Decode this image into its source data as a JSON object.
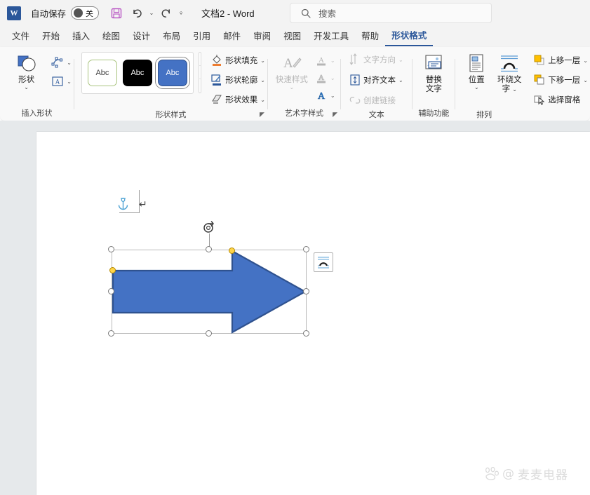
{
  "titlebar": {
    "app_icon": "word-logo-icon",
    "autosave_label": "自动保存",
    "autosave_state": "关",
    "save_icon": "save-icon",
    "undo_icon": "undo-icon",
    "redo_icon": "redo-icon",
    "qat_more_icon": "qat-customize-icon",
    "document_title": "文档2  -  Word"
  },
  "search": {
    "icon": "search-icon",
    "placeholder": "搜索"
  },
  "tabs": [
    {
      "label": "文件",
      "active": false
    },
    {
      "label": "开始",
      "active": false
    },
    {
      "label": "插入",
      "active": false
    },
    {
      "label": "绘图",
      "active": false
    },
    {
      "label": "设计",
      "active": false
    },
    {
      "label": "布局",
      "active": false
    },
    {
      "label": "引用",
      "active": false
    },
    {
      "label": "邮件",
      "active": false
    },
    {
      "label": "审阅",
      "active": false
    },
    {
      "label": "视图",
      "active": false
    },
    {
      "label": "开发工具",
      "active": false
    },
    {
      "label": "帮助",
      "active": false
    },
    {
      "label": "形状格式",
      "active": true
    }
  ],
  "ribbon": {
    "groups": [
      {
        "name": "insert-shapes",
        "label": "插入形状",
        "shapes_button": {
          "label": "形状",
          "icon": "shapes-icon",
          "chevron": "⌄"
        },
        "edit_shape_icon": "edit-shape-icon",
        "text_box_icon": "text-box-icon"
      },
      {
        "name": "shape-styles",
        "label": "形状样式",
        "gallery": [
          {
            "name": "style-subtle-line",
            "text": "Abc",
            "fill": "#ffffff",
            "border": "#a9c47f",
            "selected": false
          },
          {
            "name": "style-intense-fill-black",
            "text": "Abc",
            "fill": "#000000",
            "border": "#000000",
            "selected": false
          },
          {
            "name": "style-colored-fill-blue",
            "text": "Abc",
            "fill": "#4472c4",
            "border": "#2f528f",
            "selected": true
          }
        ],
        "gallery_nav": {
          "up": "⌃",
          "down": "⌄",
          "more": "⌄"
        },
        "buttons": [
          {
            "label": "形状填充",
            "icon": "shape-fill-icon",
            "chevron": "⌄",
            "disabled": false
          },
          {
            "label": "形状轮廓",
            "icon": "shape-outline-icon",
            "chevron": "⌄",
            "disabled": false
          },
          {
            "label": "形状效果",
            "icon": "shape-effects-icon",
            "chevron": "⌄",
            "disabled": false
          }
        ],
        "dialog_launcher": "◤"
      },
      {
        "name": "wordart-styles",
        "label": "艺术字样式",
        "quick_styles": {
          "label": "快速样式",
          "icon": "wordart-quick-styles-icon",
          "chevron": "⌄"
        },
        "buttons": [
          {
            "name": "text-fill",
            "icon": "text-fill-icon",
            "chevron": "⌄",
            "disabled": true
          },
          {
            "name": "text-outline",
            "icon": "text-outline-icon",
            "chevron": "⌄",
            "disabled": true
          },
          {
            "name": "text-effects",
            "icon": "text-effects-icon",
            "chevron": "⌄",
            "disabled": false
          }
        ],
        "dialog_launcher": "◤"
      },
      {
        "name": "text",
        "label": "文本",
        "buttons": [
          {
            "label": "文字方向",
            "icon": "text-direction-icon",
            "chevron": "⌄",
            "disabled": true
          },
          {
            "label": "对齐文本",
            "icon": "align-text-icon",
            "chevron": "⌄",
            "disabled": false
          },
          {
            "label": "创建链接",
            "icon": "create-link-icon",
            "chevron": "",
            "disabled": true
          }
        ]
      },
      {
        "name": "accessibility",
        "label": "辅助功能",
        "alt_text": {
          "label_line1": "替换",
          "label_line2": "文字",
          "icon": "alt-text-icon"
        }
      },
      {
        "name": "arrange",
        "label": "排列",
        "position": {
          "label": "位置",
          "icon": "position-icon",
          "chevron": "⌄"
        },
        "wrap_text": {
          "label_line1": "环绕文",
          "label_line2": "字",
          "icon": "wrap-text-icon",
          "chevron": "⌄"
        },
        "buttons": [
          {
            "label": "上移一层",
            "icon": "bring-forward-icon",
            "chevron": "⌄"
          },
          {
            "label": "下移一层",
            "icon": "send-backward-icon",
            "chevron": "⌄"
          },
          {
            "label": "选择窗格",
            "icon": "selection-pane-icon",
            "chevron": ""
          }
        ]
      }
    ]
  },
  "document": {
    "anchor_icon": "object-anchor-icon",
    "paragraph_mark": "↵",
    "shape": {
      "name": "right-arrow-shape",
      "fill_color": "#4472c4",
      "outline_color": "#2f528f",
      "selected": true,
      "rotation_handle_icon": "rotate-handle-icon",
      "handles": [
        "top-left",
        "top-center",
        "top-right",
        "middle-left",
        "middle-right",
        "bottom-left",
        "bottom-center",
        "bottom-right"
      ],
      "adjust_handles": [
        "arrow-width-adjust",
        "arrow-head-adjust"
      ]
    },
    "layout_options": {
      "name": "layout-options-button",
      "icon": "layout-options-icon"
    },
    "watermark": {
      "logo": "baidu-paw-icon",
      "at": "@",
      "text": "麦麦电器"
    }
  },
  "colors": {
    "accent_blue": "#2b579a",
    "shape_fill": "#4472c4",
    "shape_outline": "#2f528f",
    "adjust_handle": "#ffd54a",
    "ribbon_bg": "#f9f9f9",
    "canvas_bg": "#e6e9eb"
  }
}
